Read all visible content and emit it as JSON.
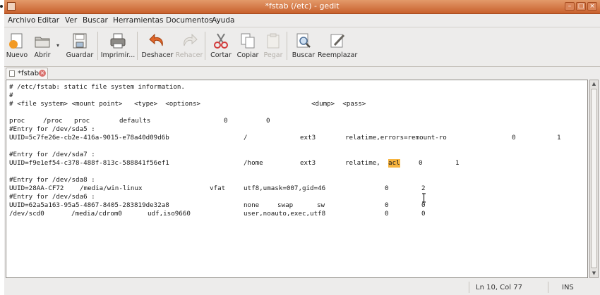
{
  "window": {
    "title": "*fstab (/etc) - gedit"
  },
  "menu": [
    "Archivo",
    "Editar",
    "Ver",
    "Buscar",
    "Herramientas",
    "Documentos",
    "Ayuda"
  ],
  "toolbar": {
    "new": "Nuevo",
    "open": "Abrir",
    "save": "Guardar",
    "print": "Imprimir...",
    "undo": "Deshacer",
    "redo": "Rehacer",
    "cut": "Cortar",
    "copy": "Copiar",
    "paste": "Pegar",
    "find": "Buscar",
    "replace": "Reemplazar"
  },
  "tab": {
    "label": "*fstab"
  },
  "editor": {
    "lines": [
      [
        "# /etc/fstab: static file system information."
      ],
      [
        "#"
      ],
      [
        "# <file system> <mount point>   <type>  <options>",
        "<dump>  <pass>"
      ],
      [
        ""
      ],
      [
        "proc",
        "/proc",
        "proc",
        "defaults",
        "0",
        "0"
      ],
      [
        "#Entry for /dev/sda5 :"
      ],
      [
        "UUID=5c7fe26e-cb2e-416a-9015-e78a40d09d6b",
        "/",
        "ext3",
        "relatime,errors=remount-ro",
        "0",
        "1"
      ],
      [
        ""
      ],
      [
        "#Entry for /dev/sda7 :"
      ],
      [
        "UUID=f9e1ef54-c378-488f-813c-588841f56ef1",
        "/home",
        "ext3",
        "relatime,",
        "acl",
        "0",
        "1"
      ],
      [
        ""
      ],
      [
        "#Entry for /dev/sda8 :"
      ],
      [
        "UUID=28AA-CF72",
        "/media/win-linux",
        "vfat",
        "utf8,umask=007,gid=46",
        "0",
        "2"
      ],
      [
        "#Entry for /dev/sda6 :"
      ],
      [
        "UUID=62a5a163-95a5-4867-8405-283819de32a8",
        "none",
        "swap",
        "sw",
        "0",
        "0"
      ],
      [
        "/dev/scd0",
        "/media/cdrom0",
        "udf,iso9660",
        "user,noauto,exec,utf8",
        "0",
        "0"
      ]
    ]
  },
  "status": {
    "position": "Ln 10, Col 77",
    "mode": "INS"
  },
  "colors": {
    "titlebar": "#c8602c",
    "highlight": "#f7b43f"
  }
}
